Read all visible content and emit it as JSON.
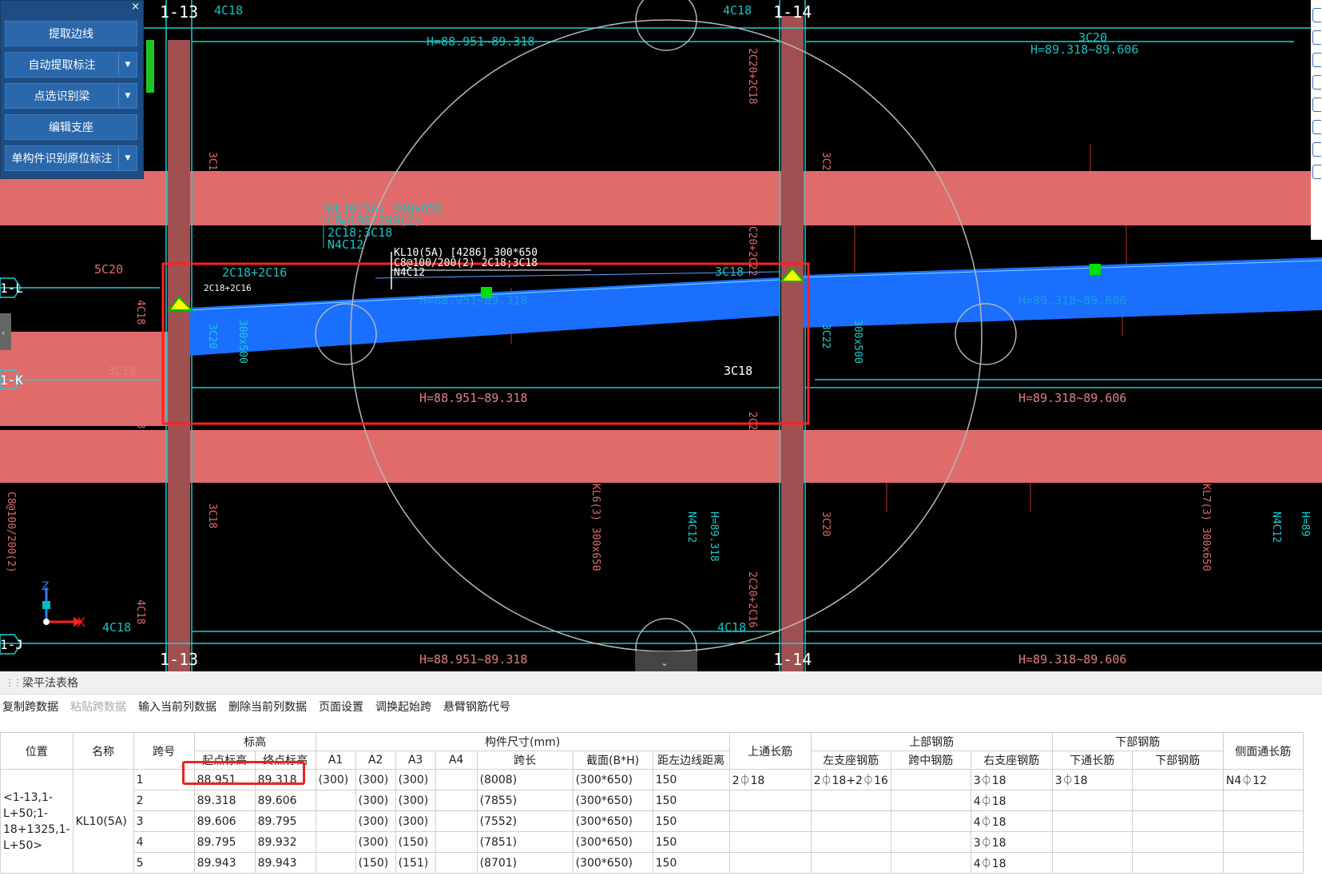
{
  "tool_panel": {
    "close": "×",
    "buttons": [
      {
        "label": "提取边线",
        "has_dropdown": false
      },
      {
        "label": "自动提取标注",
        "has_dropdown": true
      },
      {
        "label": "点选识别梁",
        "has_dropdown": true
      },
      {
        "label": "编辑支座",
        "has_dropdown": false
      },
      {
        "label": "单构件识别原位标注",
        "has_dropdown": true
      }
    ],
    "dropdown_glyph": "▼"
  },
  "drawing": {
    "axis_labels": {
      "a13_top": "1-13",
      "a14_top": "1-14",
      "a13_bot": "1-13",
      "a14_bot": "1-14",
      "row_l": "1-L",
      "row_k": "1-K",
      "row_j": "1-J"
    },
    "texts": {
      "t_4c18_a": "4C18",
      "t_4c18_b": "4C18",
      "t_4c18_c": "4C18",
      "t_4c18_d": "4C18",
      "t_h_top": "H=88.951~89.318",
      "t_3c20": "3C20",
      "t_h_top_r": "H=89.318~89.606",
      "t_kl_1": "KL10(5A) 300x650",
      "t_kl_2": "C8@100/200(2)",
      "t_kl_3": "2C18;3C18",
      "t_kl_4": "N4C12",
      "t_kl_w1": "KL10(5A) [4286] 300*650",
      "t_kl_w2": "C8@100/200(2) 2C18;3C18",
      "t_kl_w3": "N4C12",
      "t_5c20": "5C20",
      "t_2c18_2c16": "2C18+2C16",
      "t_2c18_small": "2C18+2C16",
      "t_3c18_mid": "3C18",
      "t_h_beam": "H=88.951~89.318",
      "t_h_beam_r": "H=89.318~89.606",
      "t_3c18_left": "3C18",
      "t_3c18_bot": "3C18",
      "t_h_mid": "H=88.951~89.318",
      "t_h_mid_r": "H=89.318~89.606",
      "t_h_bot": "H=88.951~89.318",
      "t_h_bot_r": "H=89.318~89.606",
      "ucs_z": "Z",
      "ucs_x": "X"
    },
    "colors": {
      "beam_fill": "#e06b6b",
      "col_fill": "#a05050",
      "selected_beam": "#1a6fff",
      "highlight": "#ff2020",
      "cad_text": "#19c2c2",
      "grid_line": "#1ad0d0"
    }
  },
  "panel": {
    "title": "梁平法表格",
    "toolbar": [
      {
        "label": "复制跨数据",
        "enabled": true
      },
      {
        "label": "粘贴跨数据",
        "enabled": false
      },
      {
        "label": "输入当前列数据",
        "enabled": true
      },
      {
        "label": "删除当前列数据",
        "enabled": true
      },
      {
        "label": "页面设置",
        "enabled": true
      },
      {
        "label": "调换起始跨",
        "enabled": true
      },
      {
        "label": "悬臂钢筋代号",
        "enabled": true
      }
    ],
    "headers": {
      "pos": "位置",
      "name": "名称",
      "span": "跨号",
      "elev": "标高",
      "elev_start": "起点标高",
      "elev_end": "终点标高",
      "dims": "构件尺寸(mm)",
      "a1": "A1",
      "a2": "A2",
      "a3": "A3",
      "a4": "A4",
      "span_len": "跨长",
      "section": "截面(B*H)",
      "edge_dist": "距左边线距离",
      "top_through": "上通长筋",
      "top_rebar": "上部钢筋",
      "left_sup": "左支座钢筋",
      "mid": "跨中钢筋",
      "right_sup": "右支座钢筋",
      "bot_rebar": "下部钢筋",
      "bot_through": "下通长筋",
      "bot": "下部钢筋",
      "side": "侧面通长筋"
    },
    "position": "<1-13,1-L+50;1-18+1325,1-L+50>",
    "name": "KL10(5A)",
    "rows": [
      {
        "span": "1",
        "start": "88.951",
        "end": "89.318",
        "a1": "(300)",
        "a2": "(300)",
        "a3": "(300)",
        "a4": "",
        "len": "(8008)",
        "section": "(300*650)",
        "dist": "150",
        "top": "2⏀18",
        "left": "2⏀18+2⏀16",
        "mid": "",
        "right": "3⏀18",
        "bthru": "3⏀18",
        "bot": "",
        "side": "N4⏀12"
      },
      {
        "span": "2",
        "start": "89.318",
        "end": "89.606",
        "a1": "",
        "a2": "(300)",
        "a3": "(300)",
        "a4": "",
        "len": "(7855)",
        "section": "(300*650)",
        "dist": "150",
        "top": "",
        "left": "",
        "mid": "",
        "right": "4⏀18",
        "bthru": "",
        "bot": "",
        "side": ""
      },
      {
        "span": "3",
        "start": "89.606",
        "end": "89.795",
        "a1": "",
        "a2": "(300)",
        "a3": "(300)",
        "a4": "",
        "len": "(7552)",
        "section": "(300*650)",
        "dist": "150",
        "top": "",
        "left": "",
        "mid": "",
        "right": "4⏀18",
        "bthru": "",
        "bot": "",
        "side": ""
      },
      {
        "span": "4",
        "start": "89.795",
        "end": "89.932",
        "a1": "",
        "a2": "(300)",
        "a3": "(150)",
        "a4": "",
        "len": "(7851)",
        "section": "(300*650)",
        "dist": "150",
        "top": "",
        "left": "",
        "mid": "",
        "right": "3⏀18",
        "bthru": "",
        "bot": "",
        "side": ""
      },
      {
        "span": "5",
        "start": "89.943",
        "end": "89.943",
        "a1": "",
        "a2": "(150)",
        "a3": "(151)",
        "a4": "",
        "len": "(8701)",
        "section": "(300*650)",
        "dist": "150",
        "top": "",
        "left": "",
        "mid": "",
        "right": "4⏀18",
        "bthru": "",
        "bot": "",
        "side": ""
      }
    ]
  }
}
